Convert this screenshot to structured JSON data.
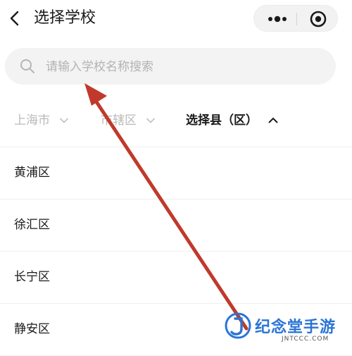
{
  "header": {
    "back_icon": "chevron-left-icon",
    "title": "选择学校",
    "capsule": {
      "more_icon": "more-dots-icon",
      "close_icon": "target-circle-icon"
    }
  },
  "search": {
    "placeholder": "请输入学校名称搜索",
    "value": "",
    "icon": "search-icon"
  },
  "filters": {
    "city": "上海市",
    "district": "市辖区",
    "county": "选择县（区）"
  },
  "districts": [
    "黄浦区",
    "徐汇区",
    "长宁区",
    "静安区"
  ],
  "watermark": {
    "brand": "纪念堂手游",
    "domain": "JNTCCC.COM"
  },
  "colors": {
    "annotation_arrow": "#c0392b",
    "watermark_blue": "#2a74d6",
    "dim_text": "#b9b9b9"
  }
}
